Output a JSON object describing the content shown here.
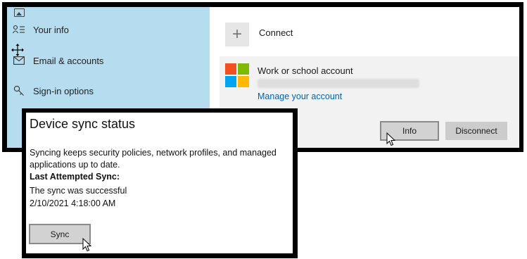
{
  "sidebar": {
    "items": [
      {
        "label": "Your info",
        "icon": "person-list-icon"
      },
      {
        "label": "Email & accounts",
        "icon": "mail-icon"
      },
      {
        "label": "Sign-in options",
        "icon": "key-icon"
      }
    ]
  },
  "main": {
    "connect_label": "Connect",
    "account": {
      "title": "Work or school account",
      "manage_link": "Manage your account"
    },
    "info_button": "Info",
    "disconnect_button": "Disconnect"
  },
  "popup": {
    "title": "Device sync status",
    "description_line1": "Syncing keeps security policies, network profiles, and managed",
    "description_line2": "applications up to date.",
    "last_sync_label": "Last Attempted Sync:",
    "status_text": "The sync was successful",
    "timestamp": "2/10/2021 4:18:00 AM",
    "sync_button": "Sync"
  },
  "colors": {
    "sidebar_bg": "#b5dcef",
    "link": "#0063b1",
    "ms_red": "#f25022",
    "ms_green": "#7fba00",
    "ms_blue": "#00a4ef",
    "ms_yellow": "#ffb900"
  }
}
